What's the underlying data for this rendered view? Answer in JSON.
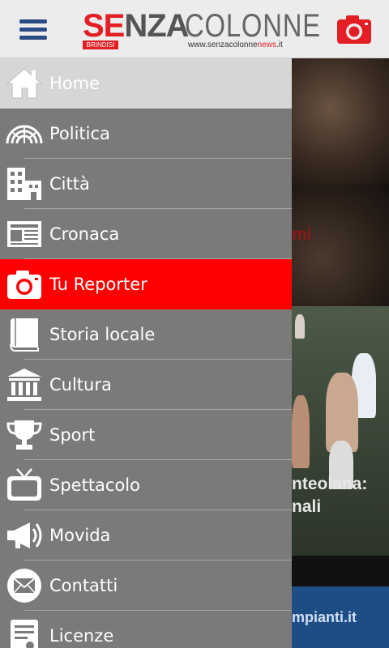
{
  "header": {
    "logo_senza_se": "SE",
    "logo_senza_nza": "NZA",
    "logo_colonne": "COLONNE",
    "logo_brindisi": "BRINDISI",
    "logo_url_prefix": "www.senzacolonne",
    "logo_url_news": "news",
    "logo_url_suffix": ".it"
  },
  "menu": {
    "items": [
      {
        "label": "Home",
        "icon": "home-icon"
      },
      {
        "label": "Politica",
        "icon": "politica-icon"
      },
      {
        "label": "Città",
        "icon": "city-icon"
      },
      {
        "label": "Cronaca",
        "icon": "newspaper-icon"
      },
      {
        "label": "Tu Reporter",
        "icon": "camera-icon"
      },
      {
        "label": "Storia locale",
        "icon": "book-icon"
      },
      {
        "label": "Cultura",
        "icon": "museum-icon"
      },
      {
        "label": "Sport",
        "icon": "trophy-icon"
      },
      {
        "label": "Spettacolo",
        "icon": "tv-icon"
      },
      {
        "label": "Movida",
        "icon": "megaphone-icon"
      },
      {
        "label": "Contatti",
        "icon": "mail-icon"
      },
      {
        "label": "Licenze",
        "icon": "license-icon"
      }
    ]
  },
  "background": {
    "headline_fragment_1": "mi",
    "headline_fragment_2_line1": "nteolana:",
    "headline_fragment_2_line2": "nali",
    "ad_fragment": "mpianti.it"
  },
  "colors": {
    "accent": "#ff0000",
    "brand_blue": "#2b4a86",
    "drawer_bg": "#7a7a7a",
    "home_bg": "#d6d6d6"
  }
}
